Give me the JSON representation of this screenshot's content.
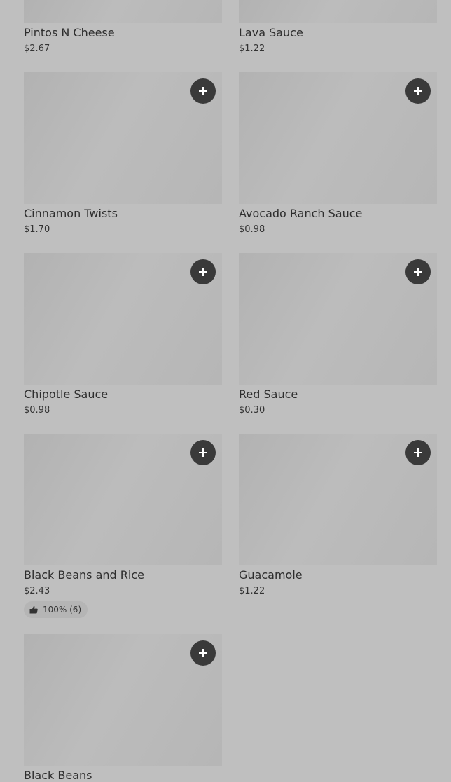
{
  "menu_items": [
    {
      "name": "Pintos N Cheese",
      "price": "$2.67"
    },
    {
      "name": "Lava Sauce",
      "price": "$1.22"
    },
    {
      "name": "Cinnamon Twists",
      "price": "$1.70",
      "add_label": "+"
    },
    {
      "name": "Avocado Ranch Sauce",
      "price": "$0.98",
      "add_label": "+"
    },
    {
      "name": "Chipotle Sauce",
      "price": "$0.98",
      "add_label": "+"
    },
    {
      "name": "Red Sauce",
      "price": "$0.30",
      "add_label": "+"
    },
    {
      "name": "Black Beans and Rice",
      "price": "$2.43",
      "add_label": "+",
      "rating": "100% (6)"
    },
    {
      "name": "Guacamole",
      "price": "$1.22",
      "add_label": "+"
    },
    {
      "name": "Black Beans",
      "add_label": "+"
    }
  ],
  "colors": {
    "background": "#bfbfbf",
    "add_button": "#3a3a3a",
    "text": "#2e2e2e"
  },
  "icons": {
    "add": "plus-icon",
    "rating": "thumbs-up-icon"
  }
}
